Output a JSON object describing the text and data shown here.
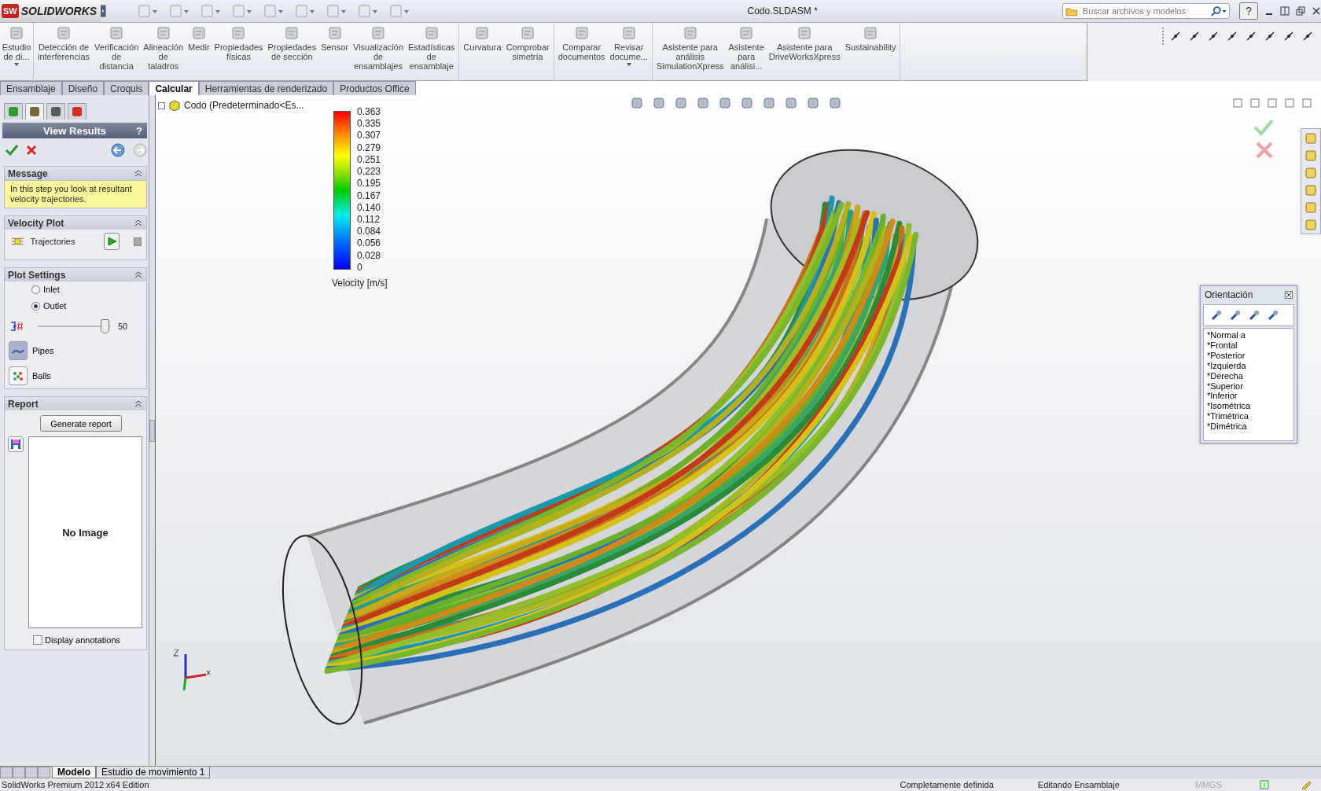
{
  "app": {
    "logo_badge": "SW",
    "logo": "SOLIDWORKS",
    "document_title": "Codo.SLDASM *",
    "search": {
      "placeholder": "Buscar archivos y modelos"
    },
    "help": "?"
  },
  "ribbon_groups": [
    [
      {
        "lines": [
          "Estudio",
          "de di..."
        ],
        "has_menu": true
      }
    ],
    [
      {
        "lines": [
          "Detección de",
          "interferencias"
        ],
        "has_menu": false
      },
      {
        "lines": [
          "Verificación",
          "de",
          "distancia"
        ],
        "has_menu": false
      },
      {
        "lines": [
          "Alineación",
          "de",
          "taladros"
        ],
        "has_menu": false
      },
      {
        "lines": [
          "Medir"
        ],
        "has_menu": false
      },
      {
        "lines": [
          "Propiedades",
          "físicas"
        ],
        "has_menu": false
      },
      {
        "lines": [
          "Propiedades",
          "de sección"
        ],
        "has_menu": false
      },
      {
        "lines": [
          "Sensor"
        ],
        "has_menu": false
      },
      {
        "lines": [
          "Visualización",
          "de",
          "ensamblajes"
        ],
        "has_menu": false
      },
      {
        "lines": [
          "Estadísticas",
          "de",
          "ensamblaje"
        ],
        "has_menu": false
      }
    ],
    [
      {
        "lines": [
          "Curvatura"
        ],
        "has_menu": false
      },
      {
        "lines": [
          "Comprobar",
          "simetría"
        ],
        "has_menu": false
      }
    ],
    [
      {
        "lines": [
          "Comparar",
          "documentos"
        ],
        "has_menu": false
      },
      {
        "lines": [
          "Revisar",
          "docume..."
        ],
        "has_menu": true
      }
    ],
    [
      {
        "lines": [
          "Asistente para",
          "análisis",
          "SimulationXpress"
        ],
        "has_menu": false
      },
      {
        "lines": [
          "Asistente",
          "para",
          "análisi..."
        ],
        "has_menu": false
      },
      {
        "lines": [
          "Asistente para",
          "DriveWorksXpress"
        ],
        "has_menu": false
      },
      {
        "lines": [
          "Sustainability"
        ],
        "has_menu": false
      }
    ]
  ],
  "command_tabs": [
    {
      "label": "Ensamblaje",
      "selected": false
    },
    {
      "label": "Diseño",
      "selected": false
    },
    {
      "label": "Croquis",
      "selected": false
    },
    {
      "label": "Calcular",
      "selected": true
    },
    {
      "label": "Herramientas de renderizado",
      "selected": false
    },
    {
      "label": "Productos Office",
      "selected": false
    }
  ],
  "panel": {
    "manager_tabs": [
      {
        "selected": false
      },
      {
        "selected": true
      },
      {
        "selected": false
      },
      {
        "selected": false
      }
    ],
    "title": "View Results",
    "help": "?",
    "message": {
      "title": "Message",
      "text": "In this step you look at resultant velocity trajectories."
    },
    "velocity_plot": {
      "title": "Velocity Plot",
      "item": "Trajectories"
    },
    "plot_settings": {
      "title": "Plot Settings",
      "radios": [
        {
          "label": "Inlet",
          "selected": false
        },
        {
          "label": "Outlet",
          "selected": true
        }
      ],
      "slider": {
        "level": 0.92,
        "reading": "50"
      },
      "toggles": [
        {
          "label": "Pipes",
          "selected": true
        },
        {
          "label": "Balls",
          "selected": false
        }
      ]
    },
    "report": {
      "title": "Report",
      "button": "Generate report",
      "preview": "No Image",
      "checkbox": {
        "label": "Display annotations",
        "checked": false
      }
    }
  },
  "viewport": {
    "tree_item": "Codo  (Predeterminado<Es...",
    "legend": {
      "ticks": [
        "0.363",
        "0.335",
        "0.307",
        "0.279",
        "0.251",
        "0.223",
        "0.195",
        "0.167",
        "0.140",
        "0.112",
        "0.084",
        "0.056",
        "0.028",
        "0"
      ],
      "title": "Velocity [m/s]"
    },
    "orientation": {
      "title": "Orientación",
      "views": [
        "*Normal a",
        "*Frontal",
        "*Posterior",
        "*Izquierda",
        "*Derecha",
        "*Superior",
        "*Inferior",
        "*Isométrica",
        "*Trimétrica",
        "*Dimétrica"
      ]
    }
  },
  "bottom_tabs": [
    {
      "label": "Modelo",
      "selected": true
    },
    {
      "label": "Estudio de movimiento 1",
      "selected": false
    }
  ],
  "status_bar": [
    {
      "text": "SolidWorks Premium 2012 x64 Edition",
      "disabled": false
    },
    {
      "text": "Completamente definida",
      "disabled": false
    },
    {
      "text": "Editando Ensamblaje",
      "disabled": false
    },
    {
      "text": "MMGS",
      "disabled": true
    }
  ]
}
